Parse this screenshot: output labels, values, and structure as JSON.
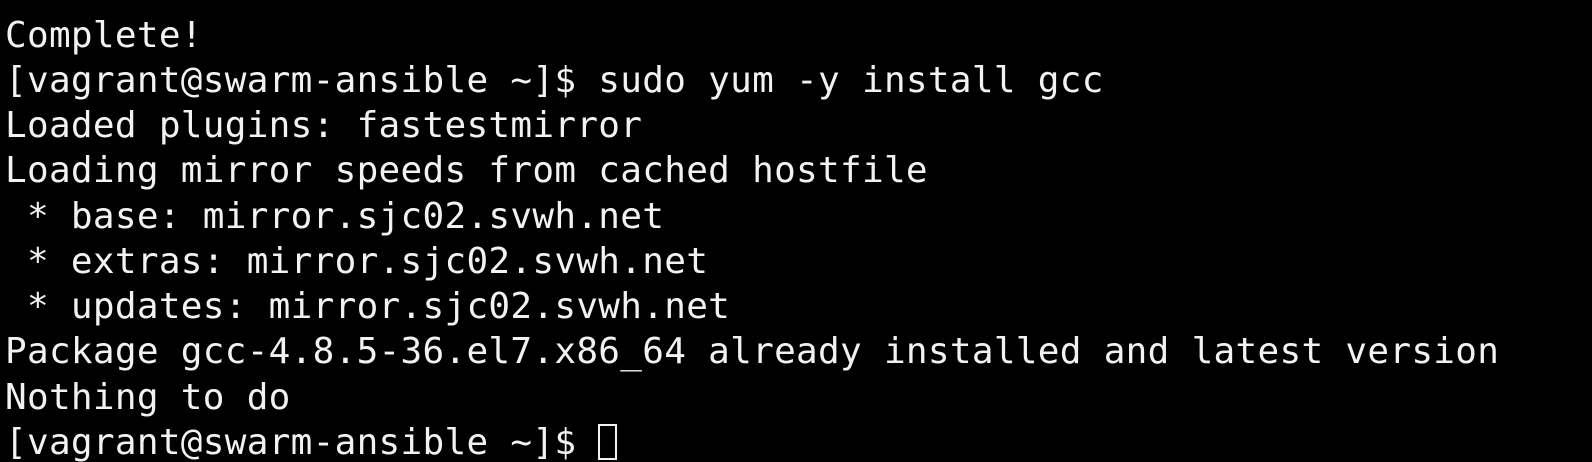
{
  "terminal": {
    "lines": [
      "Complete!",
      "[vagrant@swarm-ansible ~]$ sudo yum -y install gcc",
      "Loaded plugins: fastestmirror",
      "Loading mirror speeds from cached hostfile",
      " * base: mirror.sjc02.svwh.net",
      " * extras: mirror.sjc02.svwh.net",
      " * updates: mirror.sjc02.svwh.net",
      "Package gcc-4.8.5-36.el7.x86_64 already installed and latest version",
      "Nothing to do"
    ],
    "prompt": "[vagrant@swarm-ansible ~]$ ",
    "background_color": "#000000",
    "text_color": "#f2f2f2"
  }
}
